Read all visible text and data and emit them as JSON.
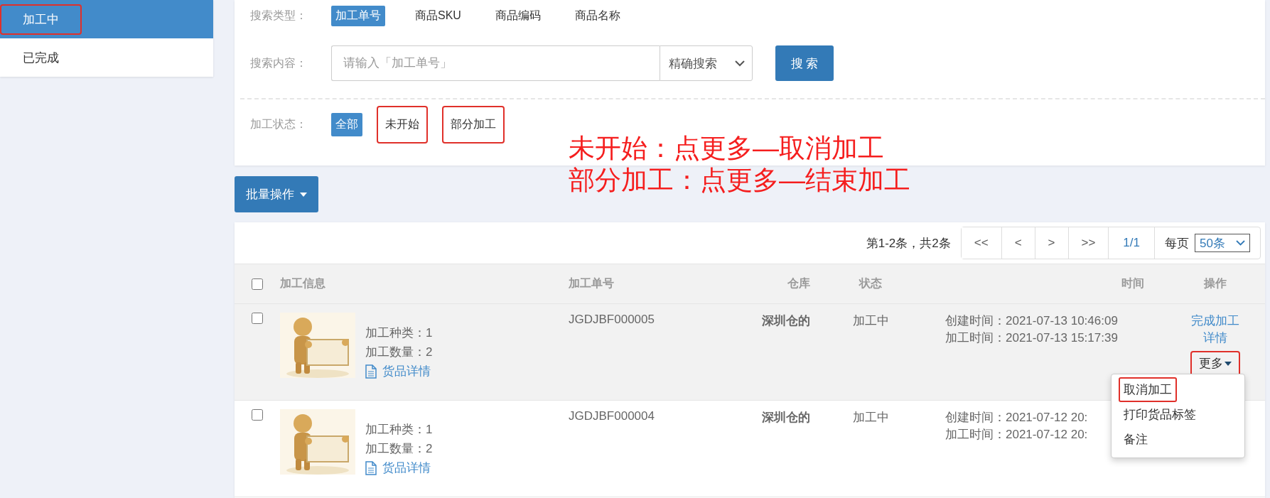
{
  "sidebar": {
    "items": [
      {
        "label": "加工中",
        "selected": true,
        "annotated": true
      },
      {
        "label": "已完成",
        "selected": false,
        "annotated": false
      }
    ]
  },
  "filters": {
    "search_type": {
      "label": "搜索类型：",
      "options": [
        {
          "label": "加工单号",
          "selected": true
        },
        {
          "label": "商品SKU",
          "selected": false
        },
        {
          "label": "商品编码",
          "selected": false
        },
        {
          "label": "商品名称",
          "selected": false
        }
      ]
    },
    "search_content": {
      "label": "搜索内容：",
      "placeholder": "请输入「加工单号」",
      "mode": "精确搜索",
      "button": "搜 索"
    },
    "status": {
      "label": "加工状态：",
      "options": [
        {
          "label": "全部",
          "selected": true,
          "annotated": false
        },
        {
          "label": "未开始",
          "selected": false,
          "annotated": true
        },
        {
          "label": "部分加工",
          "selected": false,
          "annotated": true
        }
      ]
    }
  },
  "annotations": [
    "未开始：点更多—取消加工",
    "部分加工：点更多—结束加工"
  ],
  "batch_button": "批量操作",
  "table": {
    "summary": "第1-2条，共2条",
    "pager": [
      "<<",
      "<",
      ">",
      ">>"
    ],
    "page": "1/1",
    "per_page_label": "每页",
    "per_page": "50条",
    "select_all_checked": false,
    "columns": [
      "加工信息",
      "加工单号",
      "仓库",
      "状态",
      "时间",
      "操作"
    ],
    "rows": [
      {
        "checked": false,
        "highlighted": true,
        "image": {
          "kind": "picture"
        },
        "info": [
          "加工种类：1",
          "加工数量：2"
        ],
        "detail_link": "货品详情",
        "order_no": "JGDJBF000005",
        "warehouse": "深圳仓的",
        "status": "加工中",
        "times": [
          "创建时间：2021-07-13 10:46:09",
          "加工时间：2021-07-13 15:17:39"
        ],
        "actions": [
          "完成加工",
          "详情"
        ],
        "more": {
          "label": "更多",
          "annotated": true,
          "expanded": true,
          "menu": [
            {
              "label": "取消加工",
              "annotated": true
            },
            {
              "label": "打印货品标签",
              "annotated": false
            },
            {
              "label": "备注",
              "annotated": false
            }
          ]
        }
      },
      {
        "checked": false,
        "highlighted": false,
        "image": {
          "kind": "picture"
        },
        "info": [
          "加工种类：1",
          "加工数量：2"
        ],
        "detail_link": "货品详情",
        "order_no": "JGDJBF000004",
        "warehouse": "深圳仓的",
        "status": "加工中",
        "times": [
          "创建时间：2021-07-12 20:",
          "加工时间：2021-07-12 20:"
        ]
      }
    ]
  }
}
